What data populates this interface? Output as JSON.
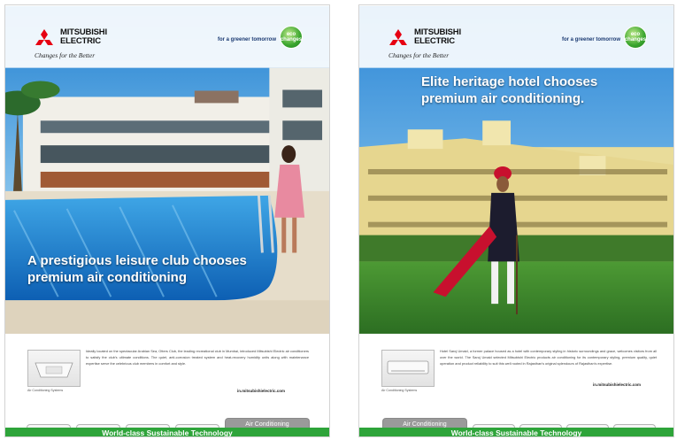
{
  "left_ad": {
    "brand": {
      "name_line1": "MITSUBISHI",
      "name_line2": "ELECTRIC",
      "tagline": "Changes for the Better"
    },
    "eco_slogan": "for a greener tomorrow",
    "eco_badge": "eco changes",
    "headline": "A prestigious leisure club chooses premium air conditioning",
    "product_caption": "Air Conditioning Systems",
    "body": "Ideally located on the spectacular Arabian Sea, Otters Club, the leading recreational club in Mumbai, introduced Mitsubishi Electric air conditioners to satisfy the club's ultimate conditions. The quiet, anti-corrosion treated system and heat-recovery humidity units along with maintenance expertise serve the celebrious club members in comfort and style.",
    "url": "in.mitsubishielectric.com",
    "tabs": [
      "",
      "",
      "",
      "",
      "Air Conditioning"
    ],
    "footer": "World-class Sustainable Technology"
  },
  "right_ad": {
    "brand": {
      "name_line1": "MITSUBISHI",
      "name_line2": "ELECTRIC",
      "tagline": "Changes for the Better"
    },
    "eco_slogan": "for a greener tomorrow",
    "eco_badge": "eco changes",
    "headline": "Elite heritage hotel chooses premium air conditioning.",
    "product_caption": "Air Conditioning Systems",
    "body": "Hotel Saroj Umaid, a former palace housed as a hotel with contemporary styling in historic surroundings and grace, welcomes visitors from all over the world. The Saroj Umaid selected Mitsubishi Electric products air conditioning for its contemporary styling, premium quality, quiet operation and product reliability to suit this well rooted in Rajasthan's original splendours of Rajasthan's expertise.",
    "url": "in.mitsubishielectric.com",
    "tabs": [
      "Air Conditioning",
      "",
      "",
      "",
      ""
    ],
    "footer": "World-class Sustainable Technology"
  },
  "colors": {
    "footer_green": "#2ea43a",
    "brand_red": "#e60012",
    "sky_blue": "#2a8fd8"
  }
}
